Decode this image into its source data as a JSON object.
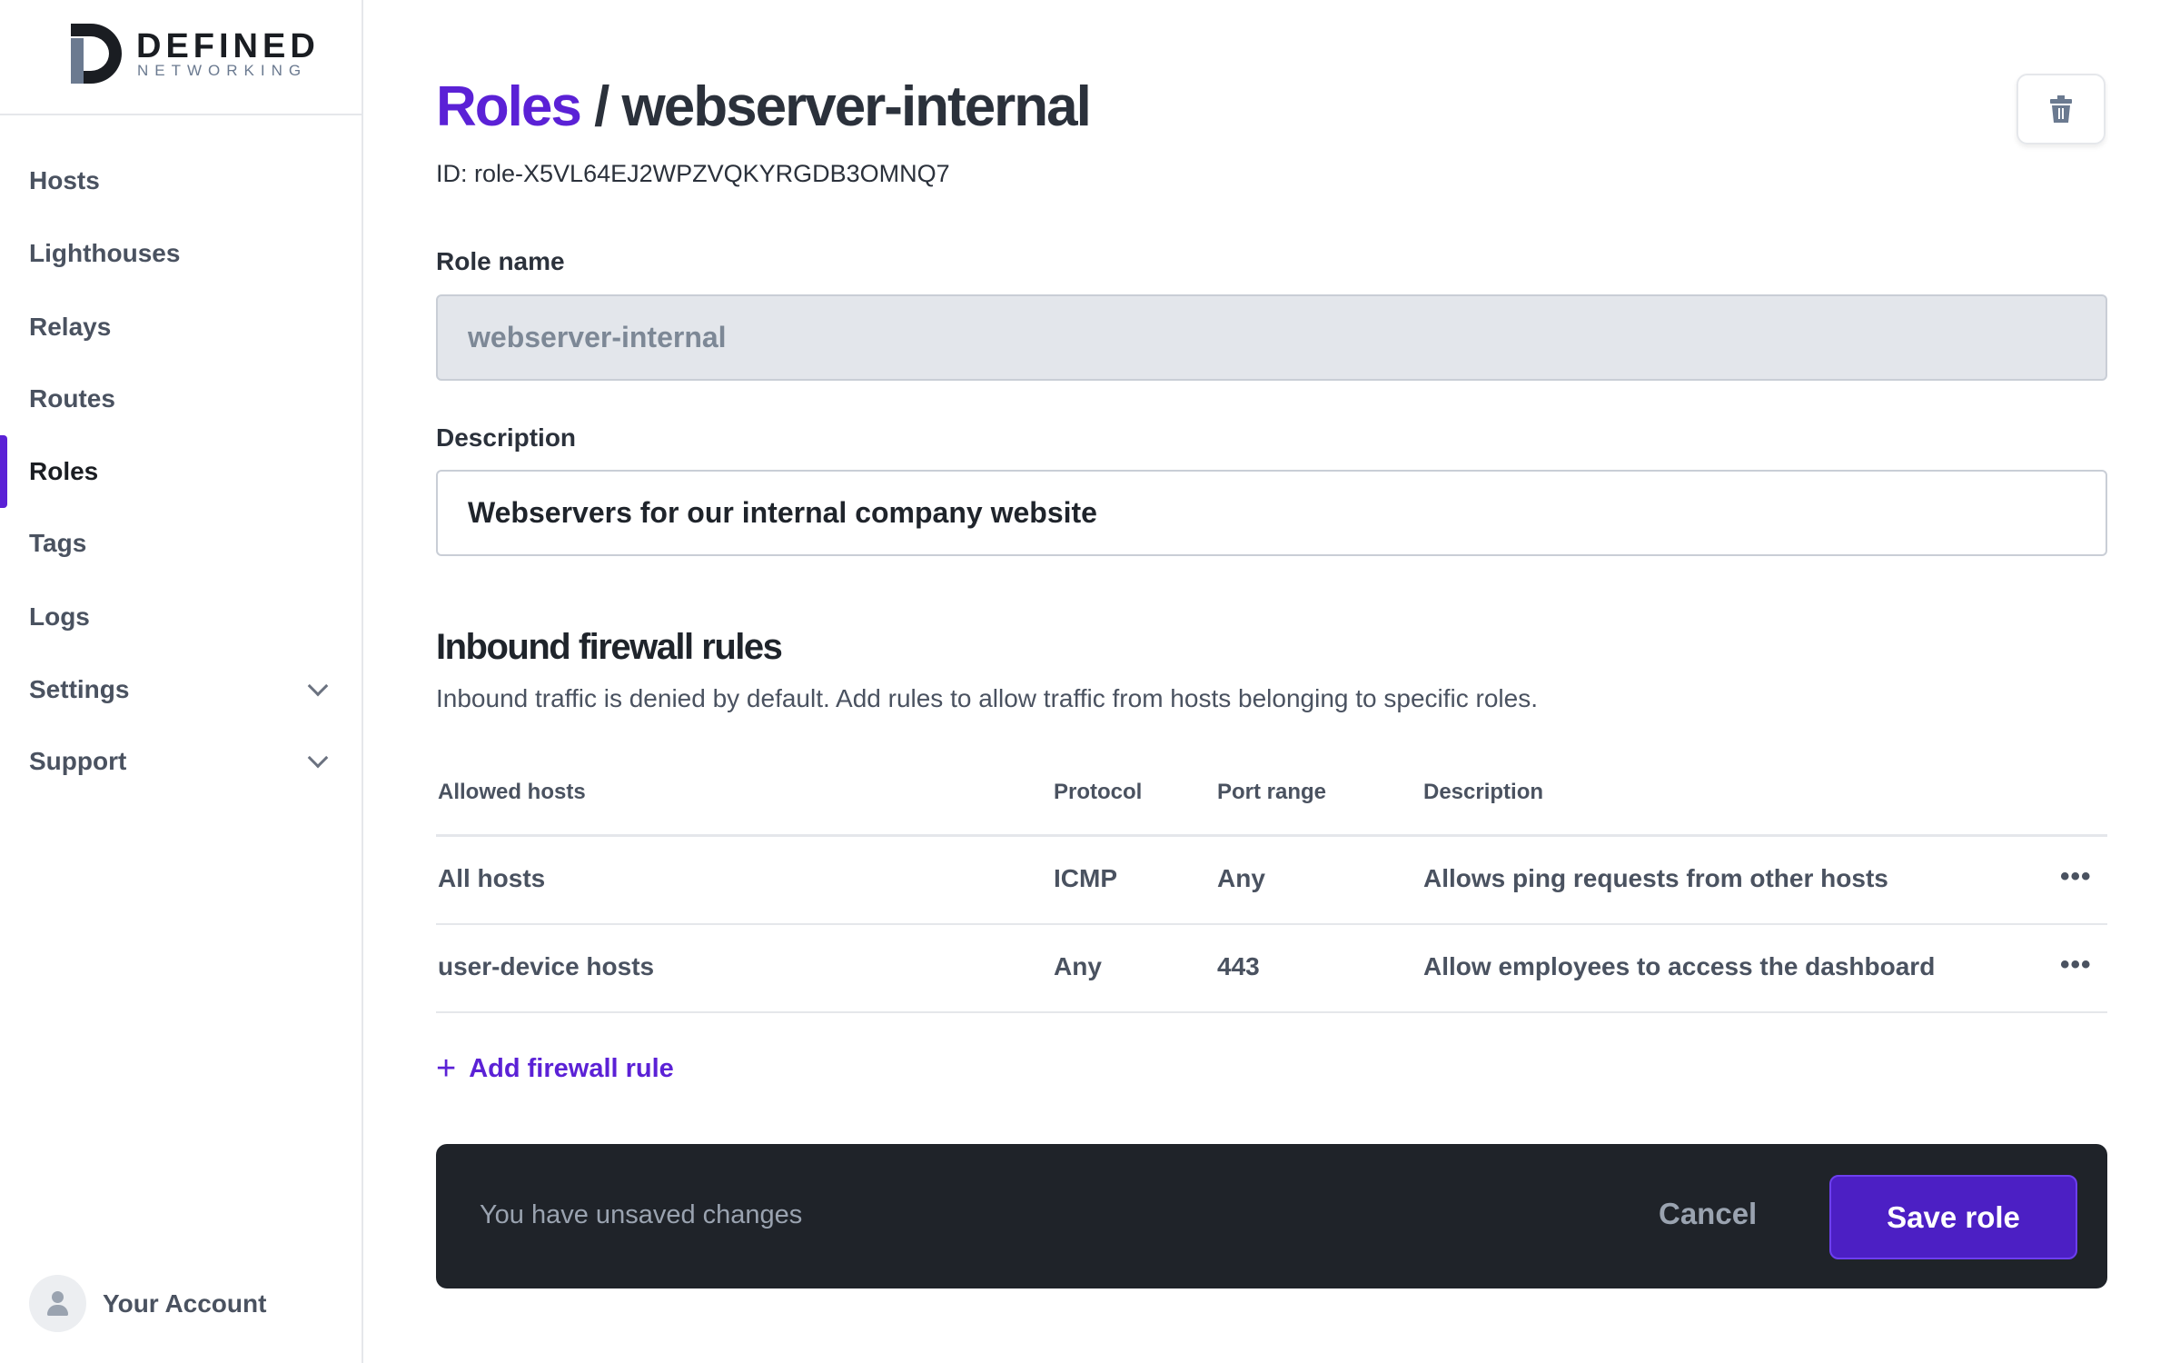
{
  "brand": {
    "line1": "DEFINED",
    "line2": "NETWORKING"
  },
  "sidebar": {
    "items": [
      {
        "label": "Hosts"
      },
      {
        "label": "Lighthouses"
      },
      {
        "label": "Relays"
      },
      {
        "label": "Routes"
      },
      {
        "label": "Roles",
        "active": true
      },
      {
        "label": "Tags"
      },
      {
        "label": "Logs"
      },
      {
        "label": "Settings",
        "expandable": true
      },
      {
        "label": "Support",
        "expandable": true
      }
    ],
    "account": "Your Account"
  },
  "header": {
    "breadcrumb": "Roles",
    "separator": "/",
    "title": "webserver-internal",
    "id": "ID: role-X5VL64EJ2WPZVQKYRGDB3OMNQ7",
    "delete_icon": "trash-icon"
  },
  "form": {
    "role_name_label": "Role name",
    "role_name_value": "webserver-internal",
    "description_label": "Description",
    "description_value": "Webservers for our internal company website"
  },
  "firewall": {
    "heading": "Inbound firewall rules",
    "subtext": "Inbound traffic is denied by default. Add rules to allow traffic from hosts belonging to specific roles.",
    "columns": [
      "Allowed hosts",
      "Protocol",
      "Port range",
      "Description"
    ],
    "rows": [
      [
        "All hosts",
        "ICMP",
        "Any",
        "Allows ping requests from other hosts"
      ],
      [
        "user-device hosts",
        "Any",
        "443",
        "Allow employees to access the dashboard"
      ]
    ],
    "add_label": "Add firewall rule"
  },
  "savebar": {
    "message": "You have unsaved changes",
    "cancel": "Cancel",
    "save": "Save role"
  },
  "colors": {
    "accent": "#5b21d6",
    "save_button": "#4c1fc4",
    "bar": "#1f2329"
  }
}
